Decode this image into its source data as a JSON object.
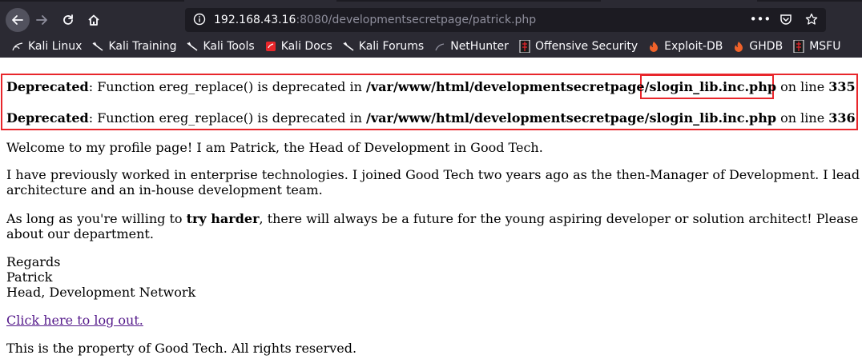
{
  "browser": {
    "url_host": "192.168.43.16",
    "url_rest": ":8080/developmentsecretpage/patrick.php",
    "bookmarks": [
      {
        "label": "Kali Linux",
        "icon": "kali-dragon-icon"
      },
      {
        "label": "Kali Training",
        "icon": "kali-dragon-icon"
      },
      {
        "label": "Kali Tools",
        "icon": "kali-dragon-icon"
      },
      {
        "label": "Kali Docs",
        "icon": "kali-docs-icon"
      },
      {
        "label": "Kali Forums",
        "icon": "kali-dragon-icon"
      },
      {
        "label": "NetHunter",
        "icon": "nethunter-icon"
      },
      {
        "label": "Offensive Security",
        "icon": "offsec-icon"
      },
      {
        "label": "Exploit-DB",
        "icon": "exploitdb-icon"
      },
      {
        "label": "GHDB",
        "icon": "exploitdb-icon"
      },
      {
        "label": "MSFU",
        "icon": "offsec-icon"
      }
    ]
  },
  "page": {
    "deprecated": [
      {
        "label": "Deprecated",
        "text": ": Function ereg_replace() is deprecated in ",
        "path": "/var/www/html/developmentsecretpage/",
        "file": "slogin_lib.inc.php",
        "on_line": " on line ",
        "line": "335"
      },
      {
        "label": "Deprecated",
        "text": ": Function ereg_replace() is deprecated in ",
        "path": "/var/www/html/developmentsecretpage/",
        "file": "slogin_lib.inc.php",
        "on_line": " on line ",
        "line": "336"
      }
    ],
    "welcome": "Welcome to my profile page! I am Patrick, the Head of Development in Good Tech.",
    "previously_line1": "I have previously worked in enterprise technologies. I joined Good Tech two years ago as the then-Manager of Development. I lead tw",
    "previously_line2": "architecture and an in-house development team.",
    "long_pre": "As long as you're willing to ",
    "long_bold": "try harder",
    "long_post": ", there will always be a future for the young aspiring developer or solution architect! Please vi",
    "long_line2": "about our department.",
    "regards": "Regards",
    "name": "Patrick",
    "title": "Head, Development Network",
    "logout": "Click here to log out.",
    "footer": "This is the property of Good Tech. All rights reserved."
  },
  "colors": {
    "chrome": "#2b2a33",
    "urlbar": "#1c1b22",
    "highlight": "#e8262b",
    "visited_link": "#551a8b"
  }
}
